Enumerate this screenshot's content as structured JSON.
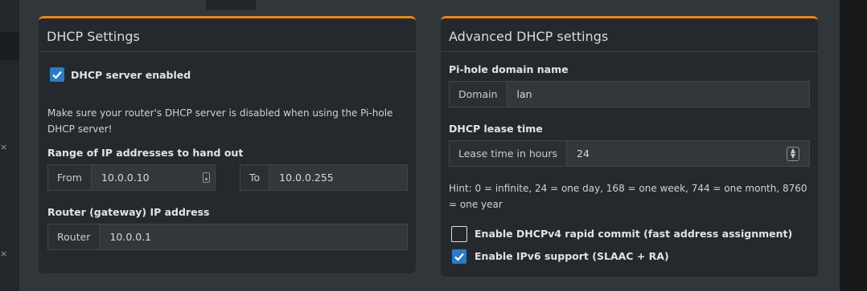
{
  "dhcp_settings": {
    "title": "DHCP Settings",
    "enabled_label": "DHCP server enabled",
    "enabled": true,
    "note": "Make sure your router's DHCP server is disabled when using the Pi-hole DHCP server!",
    "range_label": "Range of IP addresses to hand out",
    "from_label": "From",
    "from_value": "10.0.0.10",
    "to_label": "To",
    "to_value": "10.0.0.255",
    "router_section_label": "Router (gateway) IP address",
    "router_label": "Router",
    "router_value": "10.0.0.1"
  },
  "advanced": {
    "title": "Advanced DHCP settings",
    "domain_section_label": "Pi-hole domain name",
    "domain_label": "Domain",
    "domain_value": "lan",
    "lease_section_label": "DHCP lease time",
    "lease_label": "Lease time in hours",
    "lease_value": "24",
    "hint": "Hint: 0 = infinite, 24 = one day, 168 = one week, 744 = one month, 8760 = one year",
    "rapid_commit_label": "Enable DHCPv4 rapid commit (fast address assignment)",
    "rapid_commit": false,
    "ipv6_label": "Enable IPv6 support (SLAAC + RA)",
    "ipv6": true
  },
  "colors": {
    "accent": "#e8851a",
    "checkbox": "#2a7bc3",
    "card": "#25292d",
    "page": "#31363b"
  },
  "icons": [
    "checkmark-icon",
    "ip-picker-icon",
    "spinner-icon",
    "close-icon"
  ]
}
